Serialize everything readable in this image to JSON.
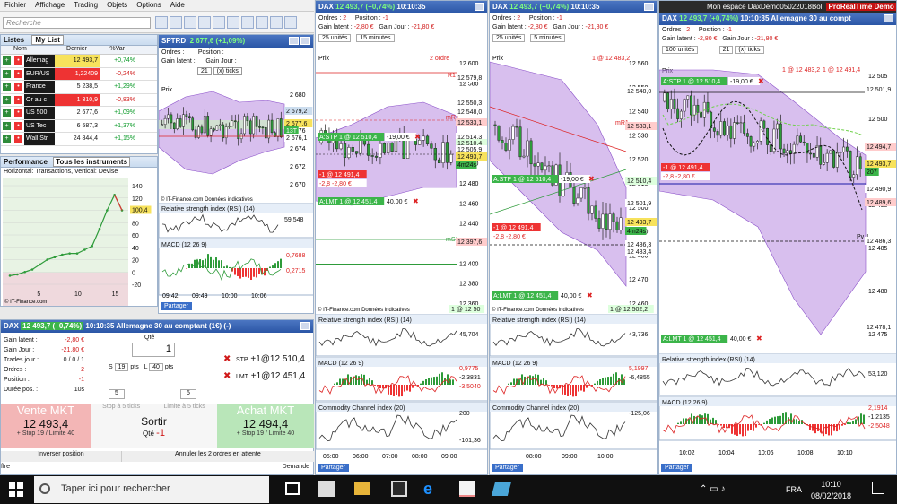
{
  "menu": [
    "Fichier",
    "Affichage",
    "Trading",
    "Objets",
    "Options",
    "Aide"
  ],
  "search_placeholder": "Recherche",
  "lists_panel": {
    "title": "Listes",
    "dropdown": "My List",
    "col_name": "Nom",
    "col_price": "Dernier",
    "col_change": "%Var"
  },
  "watchlist": [
    {
      "name": "Allemag",
      "price": "12 493,7",
      "change": "+0,74%",
      "dir": "up"
    },
    {
      "name": "EUR/US",
      "price": "1,22409",
      "change": "-0,24%",
      "dir": "dn"
    },
    {
      "name": "France",
      "price": "5 238,5",
      "change": "+1,29%",
      "dir": "up"
    },
    {
      "name": "Or au c",
      "price": "1 310,9",
      "change": "-0,83%",
      "dir": "dn"
    },
    {
      "name": "US 500",
      "price": "2 677,6",
      "change": "+1,09%",
      "dir": "up"
    },
    {
      "name": "US Tec",
      "price": "6 587,3",
      "change": "+1,37%",
      "dir": "up"
    },
    {
      "name": "Wall Str",
      "price": "24 844,4",
      "change": "+1,15%",
      "dir": "up"
    }
  ],
  "perf": {
    "title": "Performance",
    "dropdown": "Tous les instruments",
    "subtitle_h": "Horizontal: Transactions, Vertical: Devise",
    "value": "100,4",
    "yticks": [
      "140",
      "120",
      "100",
      "80",
      "60",
      "40",
      "20",
      "0",
      "-20"
    ],
    "xticks": [
      "5",
      "10",
      "15"
    ],
    "footer": "IT-Finance.com",
    "chart_data": {
      "type": "line",
      "x": [
        1,
        2,
        3,
        4,
        5,
        6,
        7,
        8,
        9,
        10,
        11,
        12,
        13,
        14,
        15,
        16
      ],
      "values": [
        -6,
        -4,
        0,
        4,
        12,
        20,
        24,
        28,
        30,
        30,
        36,
        42,
        70,
        100,
        125,
        100
      ]
    }
  },
  "sptrd": {
    "title": "SPTRD",
    "price": "2 677,6 (+1,09%)",
    "orders_label": "Ordres :",
    "position_label": "Position :",
    "gain_label": "Gain latent :",
    "gainj_label": "Gain Jour :",
    "ticks": "21",
    "ticks_unit": "(x) ticks",
    "price_tab": "Prix",
    "yticks": [
      "2 680",
      "2 678",
      "2 676",
      "2 674",
      "2 672",
      "2 670"
    ],
    "tag1": "2 679,2",
    "tag2": "2 677,6",
    "tag3": "13T",
    "tag4": "2 676,1",
    "footer": "IT-Finance.com Données indicatives",
    "rsi_label": "Relative strength index (RSI) (14)",
    "rsi_value": "59,548",
    "macd_label": "MACD (12 26 9)",
    "macd_v1": "0,7688",
    "macd_v2": "0,2715",
    "xticks": [
      "09:42",
      "09:49",
      "10:00",
      "10:06"
    ],
    "share": "Partager"
  },
  "dax_bottom": {
    "title": "DAX",
    "price": "12 493,7 (+0,74%)",
    "time": "10:10:35",
    "desc": "Allemagne 30 au comptant (1€) (-)",
    "gain_label": "Gain latent :",
    "gain": "-2,80 €",
    "gainj_label": "Gain Jour :",
    "gainj": "-21,80 €",
    "trades_label": "Trades jour :",
    "trades": "0 / 0 / 1",
    "orders_label": "Ordres :",
    "orders": "2",
    "position_label": "Position :",
    "position": "-1",
    "duree_label": "Durée pos. :",
    "duree": "10s",
    "qty_label": "Qté",
    "qty": "1",
    "s_label": "S",
    "s_val": "19",
    "pts": "pts",
    "l_label": "L",
    "l_val": "40",
    "stp_label": "STP",
    "stp": "+1@12 510,4",
    "lmt_label": "LMT",
    "lmt": "+1@12 451,4",
    "stepper1": "5",
    "stepper2": "5",
    "stop_ticks": "Stop à 5 ticks",
    "limit_ticks": "Limite à 5 ticks",
    "sell_label": "Vente MKT",
    "sell_price": "12 493,4",
    "sell_sub": "+ Stop 19 / Limite 40",
    "buy_label": "Achat MKT",
    "buy_price": "12 494,4",
    "buy_sub": "+ Stop 19 / Limite 40",
    "sortir": "Sortir",
    "qte2": "Qté",
    "qte_val": "-1",
    "invert": "Inverser position",
    "cancel": "Annuler les 2 ordres en attente",
    "ffre": "ffre",
    "demande": "Demande"
  },
  "dax1": {
    "title": "DAX",
    "price": "12 493,7 (+0,74%)",
    "time": "10:10:35",
    "orders_label": "Ordres :",
    "orders": "2",
    "position_label": "Position :",
    "position": "-1",
    "gain_label": "Gain latent :",
    "gain": "-2,80 €",
    "gainj_label": "Gain Jour :",
    "gainj": "-21,80 €",
    "units": "25 unités",
    "timeframe": "15 minutes",
    "price_tab": "Prix",
    "orders_tag": "2 ordre",
    "yticks": [
      "12 600",
      "12 580",
      "12 560",
      "12 540",
      "12 520",
      "12 500",
      "12 480",
      "12 460",
      "12 440",
      "12 420",
      "12 400",
      "12 380",
      "12 360"
    ],
    "r1": "R1",
    "mr1": "mR1",
    "ms1": "mS1",
    "lbl_12579": "12 579,8",
    "lbl_12550": "12 550,3",
    "lbl_12548": "12 548,0",
    "lbl_12533": "12 533,1",
    "lbl_12514": "12 514,3",
    "lbl_12510": "12 510,4",
    "lbl_12505": "12 505,9",
    "lbl_12493": "12 493,7",
    "lbl_12491": "12 491,4",
    "lbl_12397": "12 397,6",
    "lbl_4m": "4m24s",
    "stp_tag": "A:STP 1 @ 12 510,4",
    "stp_amt": "-19,00 €",
    "pos_tag": "-1 @ 12 491,4",
    "pos_pnl": "-2,8  -2,80 €",
    "lmt_tag": "A:LMT 1 @ 12 451,4",
    "lmt_amt": "40,00 €",
    "footer": "IT-Finance.com Données indicatives",
    "footer_price": "1 @ 12 50",
    "rsi_label": "Relative strength index (RSI) (14)",
    "rsi_value": "45,704",
    "macd_label": "MACD (12 26 9)",
    "macd_v1": "0,9775",
    "macd_v2": "-2,3831",
    "macd_v3": "-3,5040",
    "cci_label": "Commodity Channel index (20)",
    "cci_v1": "200",
    "cci_v2": "-101,36",
    "xticks": [
      "05:00",
      "06:00",
      "07:00",
      "08:00",
      "09:00"
    ],
    "share": "Partager"
  },
  "dax2": {
    "title": "DAX",
    "price": "12 493,7 (+0,74%)",
    "time": "10:10:35",
    "orders_label": "Ordres :",
    "orders": "2",
    "position_label": "Position :",
    "position": "-1",
    "gain_label": "Gain latent :",
    "gain": "-2,80 €",
    "gainj_label": "Gain Jour :",
    "gainj": "-21,80 €",
    "units": "25 unités",
    "timeframe": "5 minutes",
    "price_tab": "Prix",
    "top_tag": "1 @ 12 483,2",
    "yticks": [
      "12 560",
      "12 550",
      "12 540",
      "12 530",
      "12 520",
      "12 510",
      "12 500",
      "12 490",
      "12 480",
      "12 470",
      "12 460"
    ],
    "mr1": "mR1",
    "lbl_a": "12 548,0",
    "lbl_b": "12 533,1",
    "lbl_c": "12 510,4",
    "lbl_d": "12 501,9",
    "lbl_e": "12 493,7",
    "lbl_f": "12 486,3",
    "lbl_g": "12 483,4",
    "lbl_4m": "4m24s",
    "stp_tag": "A:STP 1 @ 12 510,4",
    "stp_amt": "-19,00 €",
    "pos_tag": "-1 @ 12 491,4",
    "pos_pnl": "-2,8  -2,80 €",
    "lmt_tag": "A:LMT 1 @ 12 451,4",
    "lmt_amt": "40,00 €",
    "footer": "IT-Finance.com Données indicatives",
    "footer_price": "1 @ 12 502,2",
    "rsi_label": "Relative strength index (RSI) (14)",
    "rsi_value": "43,736",
    "macd_label": "MACD (12 26 9)",
    "macd_v1": "5,1997",
    "macd_v2": "-6,4855",
    "cci_label": "Commodity Channel index (20)",
    "cci_v1": "-125,06",
    "xticks": [
      "08:00",
      "09:00",
      "10:00"
    ],
    "share": "Partager"
  },
  "dax3": {
    "workspace": "Mon espace DaxDémo05022018Boll",
    "brand": "ProRealTime Demo",
    "title": "DAX",
    "price": "12 493,7 (+0,74%)",
    "time": "10:10:35",
    "desc": "Allemagne 30 au compt",
    "orders_label": "Ordres :",
    "orders": "2",
    "position_label": "Position :",
    "position": "-1",
    "gain_label": "Gain latent :",
    "gain": "-2,80 €",
    "gainj_label": "Gain Jour :",
    "gainj": "-21,80 €",
    "units": "100 unités",
    "ticks": "21",
    "ticks_unit": "(x) ticks",
    "price_tab": "Prix",
    "top_tag": "1 @ 12 483,2",
    "top_tag2": "1 @ 12 491,4",
    "yticks": [
      "12 505",
      "12 500",
      "12 495",
      "12 490",
      "12 485",
      "12 480",
      "12 475"
    ],
    "lbl_a": "12 501,9",
    "lbl_b": "12 494,7",
    "lbl_c": "12 493,7",
    "lbl_d": "12 490,9",
    "lbl_e": "12 489,6",
    "lbl_f": "12 486,3",
    "lbl_g": "12 478,1",
    "lbl_207": "207",
    "pv": "Pv 1",
    "stp_tag": "A:STP 1 @ 12 510,4",
    "stp_amt": "-19,00 €",
    "pos_tag": "-1 @ 12 491,4",
    "pos_pnl": "-2,8  -2,80 €",
    "lmt_tag": "A:LMT 1 @ 12 451,4",
    "lmt_amt": "40,00 €",
    "rsi_label": "Relative strength index (RSI) (14)",
    "rsi_value": "53,120",
    "macd_label": "MACD (12 26 9)",
    "macd_v1": "2,1914",
    "macd_v2": "-1,2135",
    "macd_v3": "-2,5048",
    "xticks": [
      "10:02",
      "10:04",
      "10:06",
      "10:08",
      "10:10"
    ],
    "share": "Partager"
  },
  "taskbar": {
    "search": "Taper ici pour rechercher",
    "lang": "FRA",
    "time": "10:10",
    "date": "08/02/2018"
  }
}
